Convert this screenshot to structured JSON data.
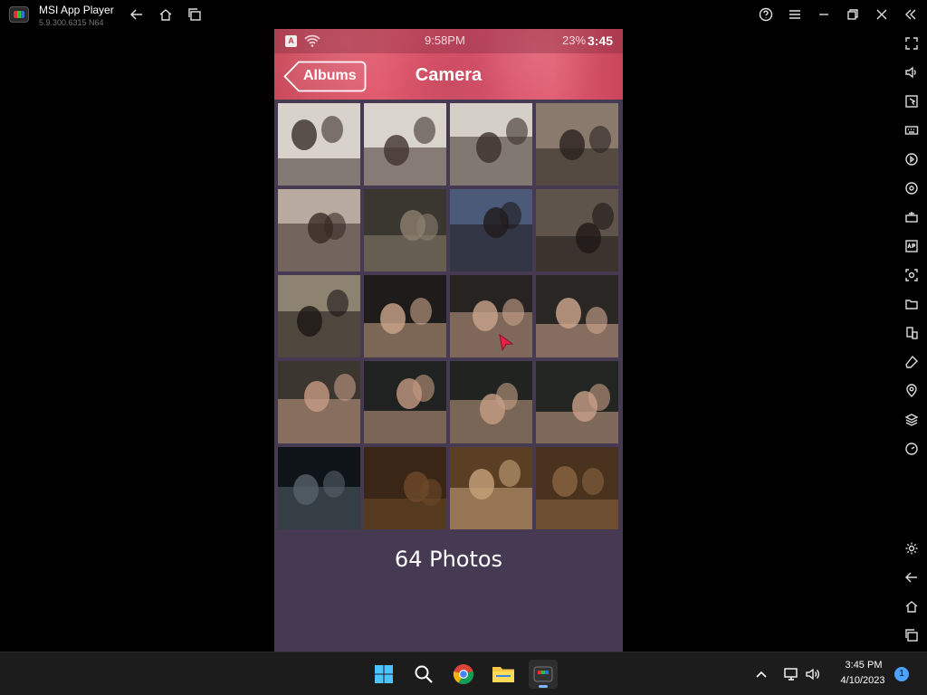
{
  "emulator": {
    "app_name": "MSI App Player",
    "version": "5.9.300.6315 N64"
  },
  "phone": {
    "status_bar": {
      "time": "9:58PM",
      "battery": "23%",
      "clock_overlay": "3:45"
    },
    "header": {
      "back_label": "Albums",
      "title": "Camera"
    },
    "photos": [
      {
        "bg": "#d8d3ca",
        "accent": "#3a2f2c"
      },
      {
        "bg": "#d9d5cd",
        "accent": "#41332e"
      },
      {
        "bg": "#d4d0c7",
        "accent": "#3c2f2a"
      },
      {
        "bg": "#8a7a6e",
        "accent": "#2a221f"
      },
      {
        "bg": "#b9aaa0",
        "accent": "#3a2a26"
      },
      {
        "bg": "#3a3630",
        "accent": "#8c7f6f"
      },
      {
        "bg": "#4a5a78",
        "accent": "#1f1a1a"
      },
      {
        "bg": "#5e544c",
        "accent": "#1e1816"
      },
      {
        "bg": "#8d8370",
        "accent": "#1b1614"
      },
      {
        "bg": "#1e1c1a",
        "accent": "#caa58a"
      },
      {
        "bg": "#262320",
        "accent": "#c8a38a"
      },
      {
        "bg": "#2a2624",
        "accent": "#d0a88f"
      },
      {
        "bg": "#3c3631",
        "accent": "#c79c83"
      },
      {
        "bg": "#1f2220",
        "accent": "#c39a82"
      },
      {
        "bg": "#202320",
        "accent": "#c59e85"
      },
      {
        "bg": "#222521",
        "accent": "#c9a088"
      },
      {
        "bg": "#0f1418",
        "accent": "#56606a"
      },
      {
        "bg": "#3a2616",
        "accent": "#6e4a2a"
      },
      {
        "bg": "#5a3f24",
        "accent": "#c7a27a"
      },
      {
        "bg": "#4a331e",
        "accent": "#8a6440"
      }
    ],
    "photo_count_label": "64 Photos"
  },
  "taskbar": {
    "time": "3:45 PM",
    "date": "4/10/2023",
    "notification_count": "1"
  },
  "colors": {
    "header_accent": "#e0566a",
    "screen_bg": "#453a52",
    "cursor": "#e8234a"
  }
}
